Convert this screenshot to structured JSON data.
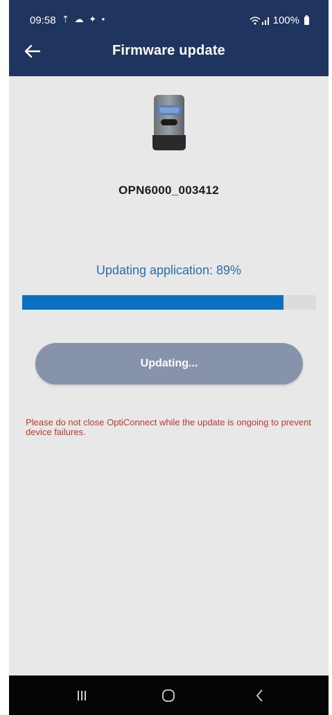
{
  "status_bar": {
    "time": "09:58",
    "left_icons": "⇡ ☁ ✦ •",
    "battery": "100%"
  },
  "app_bar": {
    "title": "Firmware update"
  },
  "device": {
    "name": "OPN6000_003412"
  },
  "progress": {
    "label": "Updating application: 89%",
    "fraction": 0.89
  },
  "button": {
    "label": "Updating..."
  },
  "warning": {
    "text": "Please do not close OptiConnect while the update is ongoing to prevent device failures."
  },
  "colors": {
    "header": "#1f3560",
    "progress_fill": "#0d6fbd",
    "button": "#8792ab",
    "warning": "#c0392b"
  }
}
